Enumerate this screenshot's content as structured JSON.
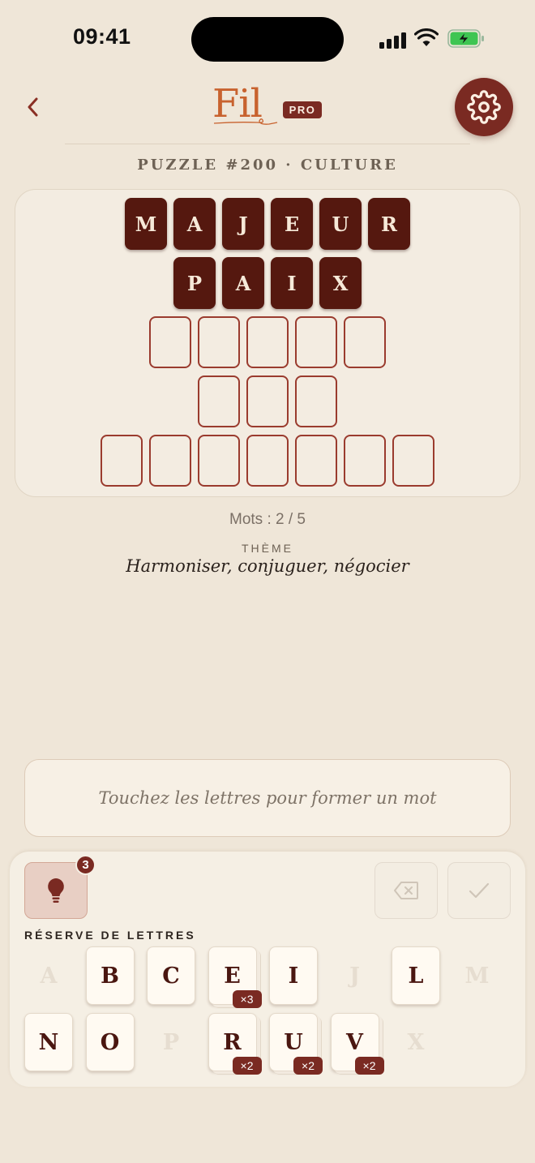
{
  "status_bar": {
    "time": "09:41"
  },
  "header": {
    "logo_text": "Fil",
    "badge": "PRO"
  },
  "puzzle": {
    "label": "PUZZLE #200 · CULTURE"
  },
  "board": {
    "rows": [
      {
        "letters": [
          "M",
          "A",
          "J",
          "E",
          "U",
          "R"
        ],
        "found": true
      },
      {
        "letters": [
          "P",
          "A",
          "I",
          "X"
        ],
        "found": true
      },
      {
        "letters": [
          "",
          "",
          "",
          "",
          ""
        ],
        "found": false
      },
      {
        "letters": [
          "",
          "",
          ""
        ],
        "found": false
      },
      {
        "letters": [
          "",
          "",
          "",
          "",
          "",
          "",
          ""
        ],
        "found": false
      }
    ]
  },
  "progress": {
    "words_label": "Mots : 2 / 5"
  },
  "theme": {
    "label": "THÈME",
    "text": "Harmoniser, conjuguer, négocier"
  },
  "input": {
    "placeholder": "Touchez les lettres pour former un mot"
  },
  "controls": {
    "hint_count": "3"
  },
  "reserve": {
    "label": "RÉSERVE DE LETTRES",
    "row1": [
      {
        "letter": "A",
        "available": false,
        "count": ""
      },
      {
        "letter": "B",
        "available": true,
        "count": ""
      },
      {
        "letter": "C",
        "available": true,
        "count": ""
      },
      {
        "letter": "E",
        "available": true,
        "count": "×3"
      },
      {
        "letter": "I",
        "available": true,
        "count": ""
      },
      {
        "letter": "J",
        "available": false,
        "count": ""
      },
      {
        "letter": "L",
        "available": true,
        "count": ""
      },
      {
        "letter": "M",
        "available": false,
        "count": ""
      }
    ],
    "row2": [
      {
        "letter": "N",
        "available": true,
        "count": ""
      },
      {
        "letter": "O",
        "available": true,
        "count": ""
      },
      {
        "letter": "P",
        "available": false,
        "count": ""
      },
      {
        "letter": "R",
        "available": true,
        "count": "×2"
      },
      {
        "letter": "U",
        "available": true,
        "count": "×2"
      },
      {
        "letter": "V",
        "available": true,
        "count": "×2"
      },
      {
        "letter": "X",
        "available": false,
        "count": ""
      }
    ]
  },
  "colors": {
    "background": "#efe6d8",
    "accent": "#7a2a22",
    "tile_filled": "#55180f",
    "logo": "#c8622e"
  }
}
